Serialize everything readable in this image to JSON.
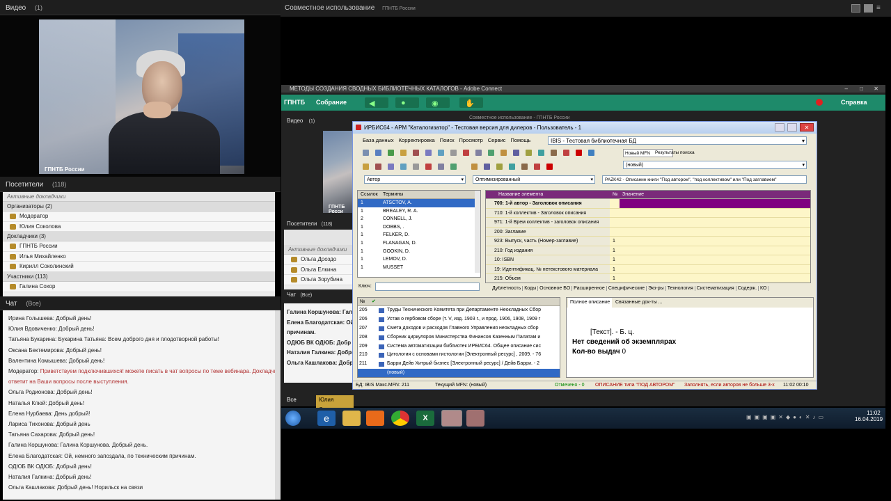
{
  "left": {
    "video": {
      "title": "Видео",
      "count": "(1)",
      "label": "ГПНТБ России"
    },
    "attendees": {
      "title": "Посетители",
      "count": "(118)",
      "active_speakers": "Активные докладчики",
      "sections": [
        {
          "name": "Организаторы (2)",
          "items": [
            "Модератор",
            "Юлия Соколова"
          ]
        },
        {
          "name": "Докладчики (3)",
          "items": [
            "ГПНТБ России",
            "Илья Михайленко",
            "Кирилл Соколинский"
          ]
        },
        {
          "name": "Участники (113)",
          "items": [
            "Галина Сохор"
          ]
        }
      ]
    },
    "chat": {
      "title": "Чат",
      "scope": "(Все)",
      "messages": [
        {
          "author": "Ирина Голышева:",
          "text": "Добрый день!"
        },
        {
          "author": "Юлия Вдовиченко:",
          "text": "Добрый день!"
        },
        {
          "author": "Татьяна Букарина:",
          "text": "Букарина Татьяна: Всем доброго дня и плодотворной работы!"
        },
        {
          "author": "Оксана Бектемирова:",
          "text": "Добрый день!"
        },
        {
          "author": "Валентина Комышева:",
          "text": "Добрый день!"
        },
        {
          "author": "Модератор:",
          "text": "Приветствуем подключившихся! можете писать в чат вопросы по теме вебинара. Докладчик",
          "red": true
        },
        {
          "author": "",
          "text": "ответит на Ваши вопросы после выступления.",
          "red": true
        },
        {
          "author": "Ольга Родионова:",
          "text": "Добрый день!"
        },
        {
          "author": "Наталья Клюй:",
          "text": "Добрый день!"
        },
        {
          "author": "Елена Нурбаева:",
          "text": "День добрый!"
        },
        {
          "author": "Лариса Тихонова:",
          "text": "Добрый день"
        },
        {
          "author": "Татьяна Сахарова:",
          "text": "Добрый день!"
        },
        {
          "author": "Галина Коршунова:",
          "text": "Галина Коршунова. Добрый день."
        },
        {
          "author": "Елена Благодатская:",
          "text": "Ой, немного запоздала, по техническим причинам."
        },
        {
          "author": "ОДЮБ ВК ОДЮБ:",
          "text": "Добрый день!"
        },
        {
          "author": "Наталия Галкина:",
          "text": "Добрый день!"
        },
        {
          "author": "Ольга Кашлакова:",
          "text": "Добрый день! Норильск на связи"
        }
      ]
    }
  },
  "right": {
    "header": {
      "title": "Совместное использование",
      "owner": "ГПНТБ России"
    },
    "adobe": {
      "window_title": "МЕТОДЫ СОЗДАНИЯ СВОДНЫХ БИБЛИОТЕЧНЫХ КАТАЛОГОВ - Adobe Connect",
      "logo": "ГПНТБ",
      "meeting": "Собрание",
      "help": "Справка",
      "inner_video": "Видео",
      "inner_video_count": "(1)",
      "inner_label": "ГПНТБ Росси",
      "inner_att_title": "Посетители",
      "inner_att_count": "(118)",
      "inner_active": "Активные докладчики",
      "inner_att": [
        "Ольга Дроздо",
        "Ольга Елкина",
        "Ольга Зорубина"
      ],
      "inner_chat": "Чат",
      "inner_chat_scope": "(Все)",
      "inner_chat_rows": [
        "Галина Коршунова: Галина",
        "Елена Благодатская: Ой,",
        "причинам.",
        "ОДЮБ ВК ОДЮБ: Добр",
        "Наталия Галкина: Добры",
        "Ольга Кашлакова: Добры"
      ],
      "bottom_left": "Все",
      "bottom_name": "Юлия Соколова",
      "behind_title": "Совместное использование - ГПНТБ России"
    },
    "irbis": {
      "title": "ИРБИС64 - АРМ \"Каталогизатор\" - Тестовая версия для дилеров - Пользователь - 1",
      "menu": [
        "База данных",
        "Корректировка",
        "Поиск",
        "Просмотр",
        "Сервис",
        "Помощь"
      ],
      "db": "IBIS - Тестовая библиотечная БД",
      "tab_new": "Новый MFN",
      "tab_results": "Результаты поиска",
      "new_combo": "(новый)",
      "search_field": "Автор",
      "mode": "Оптимизированный",
      "worksheet": "PAZK42 - Описание книги \"Под автором\", \"под коллективом\" или \"Под заглавием\"",
      "terms_head": [
        "Ссылок",
        "Термины"
      ],
      "terms": [
        {
          "n": "1",
          "t": "ATSCTOV, A."
        },
        {
          "n": "1",
          "t": "BREALEY, R. A."
        },
        {
          "n": "2",
          "t": "CONNELL, J."
        },
        {
          "n": "1",
          "t": "DOBBS, ."
        },
        {
          "n": "1",
          "t": "FELKER, D."
        },
        {
          "n": "1",
          "t": "FLANAGAN, D."
        },
        {
          "n": "1",
          "t": "GOOKIN, D."
        },
        {
          "n": "1",
          "t": "LEMOV, D."
        },
        {
          "n": "1",
          "t": "MUSSET"
        }
      ],
      "key_label": "Ключ:",
      "fields_head": [
        "Название элемента",
        "№",
        "Значение"
      ],
      "fields": [
        {
          "name": "700: 1-й автор - Заголовок описания",
          "n": "",
          "bold": true
        },
        {
          "name": "710: 1-й коллектив - Заголовок описания",
          "n": ""
        },
        {
          "name": "971: 1-й Врем коллектив - заголовок описания",
          "n": ""
        },
        {
          "name": "200: Заглавие",
          "n": ""
        },
        {
          "name": "923: Выпуск, часть (Номер-заглавие)",
          "n": "1"
        },
        {
          "name": "210: Год издания",
          "n": "1"
        },
        {
          "name": "10: ISBN",
          "n": "1"
        },
        {
          "name": "19: Идентификац. № нетекстового материала",
          "n": "1"
        },
        {
          "name": "215: Объем",
          "n": "1"
        }
      ],
      "tabs": [
        "Дублетность",
        "Коды",
        "Основное БО",
        "Расширенное",
        "Специфические",
        "Экз-ры",
        "Технология",
        "Систематизация",
        "Содерж.",
        "КО"
      ],
      "records_head": "№",
      "records": [
        {
          "n": "205",
          "t": "Труды Технического Комитета при Департаменте Неокладных Сбор"
        },
        {
          "n": "206",
          "t": "Устав о гербовом сборе (т. V, изд. 1903 г., и прод. 1906, 1908, 1909 г"
        },
        {
          "n": "207",
          "t": "Смета доходов и расходов Главного Управления неокладных сбор"
        },
        {
          "n": "208",
          "t": "Сборник циркуляров Министерства Финансов Казенным Палатам и"
        },
        {
          "n": "209",
          "t": "Система автоматизации библиотек ИРБИС64. Общее описание сис"
        },
        {
          "n": "210",
          "t": "Цитология с основами гистологии [Электронный ресурс] , 2009. - 76"
        },
        {
          "n": "211",
          "t": "Барри Дейв Хитрый бизнес [Электронный ресурс] / Дейв Барри. - 2"
        },
        {
          "n": "",
          "t": "(новый)",
          "selected": true
        }
      ],
      "preview_tabs": [
        "Полное описание",
        "Связанные док-ты ..."
      ],
      "preview": {
        "line1": "[Текст]. - Б. ц.",
        "line2": "Нет сведений об экземплярах",
        "line3_label": "Кол-во выдач",
        "line3_val": "0"
      },
      "status": {
        "db": "БД: IBIS Макс.MFN: 211",
        "current": "Текущий MFN: (новый)",
        "marked": "Отмечено - 0",
        "desc": "ОПИСАНИЕ типа \"ПОД АВТОРОМ\"",
        "hint": "Заполнять, если авторов не больше 3-х",
        "time": "11:02 00:10"
      }
    },
    "taskbar": {
      "time": "11:02",
      "date": "16.04.2019"
    }
  },
  "colors": {
    "accent_green": "#1e8a6a",
    "irbis_purple": "#800080",
    "irbis_value_bg": "#fdf6c8"
  }
}
